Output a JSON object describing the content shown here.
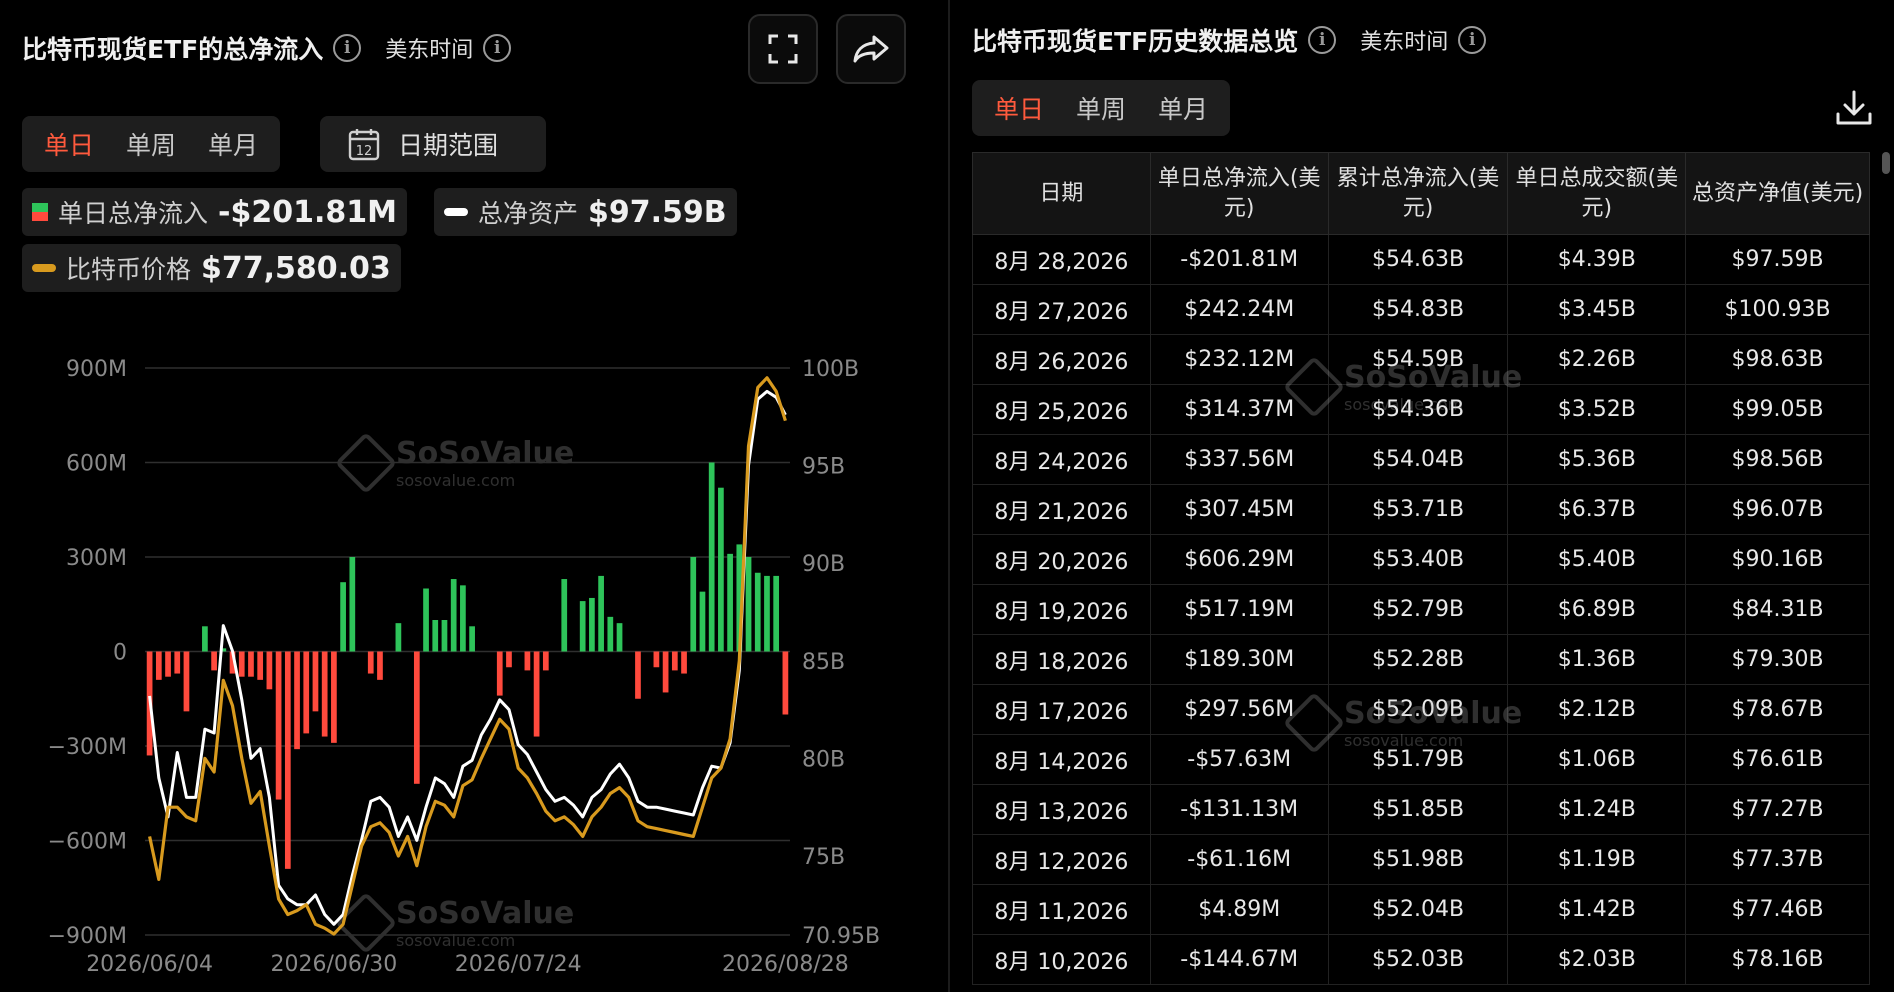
{
  "left": {
    "title": "比特币现货ETF的总净流入",
    "timezone": "美东时间",
    "tabs": [
      {
        "label": "单日",
        "active": true
      },
      {
        "label": "单周",
        "active": false
      },
      {
        "label": "单月",
        "active": false
      }
    ],
    "date_range_label": "日期范围",
    "calendar_day": "12",
    "legend": [
      {
        "name": "单日总净流入",
        "value": "-$201.81M"
      },
      {
        "name": "总净资产",
        "value": "$97.59B"
      },
      {
        "name": "比特币价格",
        "value": "$77,580.03"
      }
    ]
  },
  "colors": {
    "positive": "#2ec45a",
    "negative": "#ff4a3d",
    "price": "#d89a1e",
    "assets": "#ffffff",
    "accent": "#ff5a3d"
  },
  "icons": {
    "fullscreen": "fullscreen-icon",
    "share": "share-icon",
    "download": "download-icon",
    "calendar": "calendar-icon",
    "info": "info-icon"
  },
  "watermark": {
    "brand": "SoSoValue",
    "url": "sosovalue.com"
  },
  "chart_data": {
    "type": "bar",
    "x_tick_labels": [
      "2026/06/04",
      "2026/06/30",
      "2026/07/24",
      "2026/08/28"
    ],
    "x_tick_index": [
      0,
      20,
      40,
      69
    ],
    "y_left_ticks": [
      "900M",
      "600M",
      "300M",
      "0",
      "−300M",
      "−600M",
      "−900M"
    ],
    "y_left_values": [
      900,
      600,
      300,
      0,
      -300,
      -600,
      -900
    ],
    "ylim_left": [
      -900,
      900
    ],
    "y_right_ticks": [
      "100B",
      "95B",
      "90B",
      "85B",
      "80B",
      "75B",
      "70.95B"
    ],
    "y_right_values": [
      100,
      95,
      90,
      85,
      80,
      75,
      70.95
    ],
    "ylim_right": [
      70.95,
      100
    ],
    "series": [
      {
        "values": [
          -330,
          -90,
          -80,
          -70,
          -190,
          0,
          80,
          -60,
          10,
          -70,
          -80,
          -80,
          -90,
          -120,
          -470,
          -690,
          -310,
          -260,
          -190,
          -270,
          -290,
          220,
          300,
          0,
          -70,
          -90,
          0,
          90,
          0,
          -420,
          200,
          100,
          100,
          230,
          210,
          80,
          0,
          0,
          -140,
          -50,
          0,
          -60,
          -270,
          -60,
          0,
          230,
          0,
          160,
          170,
          240,
          110,
          90,
          0,
          -150,
          0,
          -50,
          -130,
          -60,
          -70,
          300,
          190,
          600,
          520,
          310,
          340,
          300,
          250,
          240,
          240,
          -200
        ]
      },
      {
        "values": [
          83.2,
          79.0,
          77.0,
          80.3,
          78.0,
          78.0,
          81.5,
          81.3,
          86.8,
          85.5,
          83.0,
          80.0,
          80.5,
          78.0,
          73.5,
          72.8,
          72.5,
          72.5,
          73.0,
          72.0,
          71.5,
          72.0,
          74.0,
          75.8,
          77.8,
          78.0,
          77.5,
          76.0,
          77.0,
          75.8,
          77.5,
          79.0,
          78.7,
          78.0,
          79.6,
          79.9,
          81.2,
          82.0,
          83.0,
          82.5,
          80.7,
          80.2,
          79.3,
          78.4,
          77.8,
          78.0,
          77.6,
          77.0,
          78.0,
          78.4,
          79.2,
          79.7,
          79.0,
          77.8,
          77.5,
          77.5,
          77.4,
          77.3,
          77.2,
          77.1,
          78.5,
          79.6,
          79.5,
          80.8,
          84.5,
          95.0,
          98.4,
          98.8,
          98.5,
          97.6
        ]
      },
      {
        "values": [
          76.0,
          73.8,
          77.5,
          77.5,
          77.0,
          76.8,
          80.0,
          79.3,
          84.0,
          82.7,
          80.0,
          77.7,
          78.3,
          75.5,
          72.8,
          72.0,
          72.2,
          72.5,
          71.5,
          71.3,
          71.0,
          71.5,
          73.5,
          75.5,
          76.5,
          76.7,
          76.2,
          75.0,
          76.0,
          74.5,
          76.5,
          77.8,
          77.6,
          77.0,
          78.6,
          78.9,
          80.0,
          81.0,
          82.0,
          81.5,
          79.5,
          79.0,
          78.2,
          77.3,
          76.8,
          77.0,
          76.6,
          76.0,
          77.0,
          77.5,
          78.2,
          78.5,
          78.0,
          76.8,
          76.5,
          76.4,
          76.3,
          76.2,
          76.1,
          76.0,
          77.5,
          79.0,
          79.5,
          81.0,
          85.0,
          96.0,
          99.0,
          99.5,
          98.8,
          97.3
        ]
      }
    ]
  },
  "right": {
    "title": "比特币现货ETF历史数据总览",
    "timezone": "美东时间",
    "tabs": [
      {
        "label": "单日",
        "active": true
      },
      {
        "label": "单周",
        "active": false
      },
      {
        "label": "单月",
        "active": false
      }
    ],
    "columns": [
      "日期",
      "单日总净流入(美元)",
      "累计总净流入(美元)",
      "单日总成交额(美元)",
      "总资产净值(美元)"
    ],
    "rows": [
      {
        "date": "8月 28,2026",
        "flow": "-$201.81M",
        "sign": "neg",
        "cum": "$54.63B",
        "vol": "$4.39B",
        "nav": "$97.59B"
      },
      {
        "date": "8月 27,2026",
        "flow": "$242.24M",
        "sign": "pos",
        "cum": "$54.83B",
        "vol": "$3.45B",
        "nav": "$100.93B"
      },
      {
        "date": "8月 26,2026",
        "flow": "$232.12M",
        "sign": "pos",
        "cum": "$54.59B",
        "vol": "$2.26B",
        "nav": "$98.63B"
      },
      {
        "date": "8月 25,2026",
        "flow": "$314.37M",
        "sign": "pos",
        "cum": "$54.36B",
        "vol": "$3.52B",
        "nav": "$99.05B"
      },
      {
        "date": "8月 24,2026",
        "flow": "$337.56M",
        "sign": "pos",
        "cum": "$54.04B",
        "vol": "$5.36B",
        "nav": "$98.56B"
      },
      {
        "date": "8月 21,2026",
        "flow": "$307.45M",
        "sign": "pos",
        "cum": "$53.71B",
        "vol": "$6.37B",
        "nav": "$96.07B"
      },
      {
        "date": "8月 20,2026",
        "flow": "$606.29M",
        "sign": "pos",
        "cum": "$53.40B",
        "vol": "$5.40B",
        "nav": "$90.16B"
      },
      {
        "date": "8月 19,2026",
        "flow": "$517.19M",
        "sign": "pos",
        "cum": "$52.79B",
        "vol": "$6.89B",
        "nav": "$84.31B"
      },
      {
        "date": "8月 18,2026",
        "flow": "$189.30M",
        "sign": "pos",
        "cum": "$52.28B",
        "vol": "$1.36B",
        "nav": "$79.30B"
      },
      {
        "date": "8月 17,2026",
        "flow": "$297.56M",
        "sign": "pos",
        "cum": "$52.09B",
        "vol": "$2.12B",
        "nav": "$78.67B"
      },
      {
        "date": "8月 14,2026",
        "flow": "-$57.63M",
        "sign": "neg",
        "cum": "$51.79B",
        "vol": "$1.06B",
        "nav": "$76.61B"
      },
      {
        "date": "8月 13,2026",
        "flow": "-$131.13M",
        "sign": "neg",
        "cum": "$51.85B",
        "vol": "$1.24B",
        "nav": "$77.27B"
      },
      {
        "date": "8月 12,2026",
        "flow": "-$61.16M",
        "sign": "neg",
        "cum": "$51.98B",
        "vol": "$1.19B",
        "nav": "$77.37B"
      },
      {
        "date": "8月 11,2026",
        "flow": "$4.89M",
        "sign": "pos",
        "cum": "$52.04B",
        "vol": "$1.42B",
        "nav": "$77.46B"
      },
      {
        "date": "8月 10,2026",
        "flow": "-$144.67M",
        "sign": "neg",
        "cum": "$52.03B",
        "vol": "$2.03B",
        "nav": "$78.16B"
      }
    ]
  }
}
